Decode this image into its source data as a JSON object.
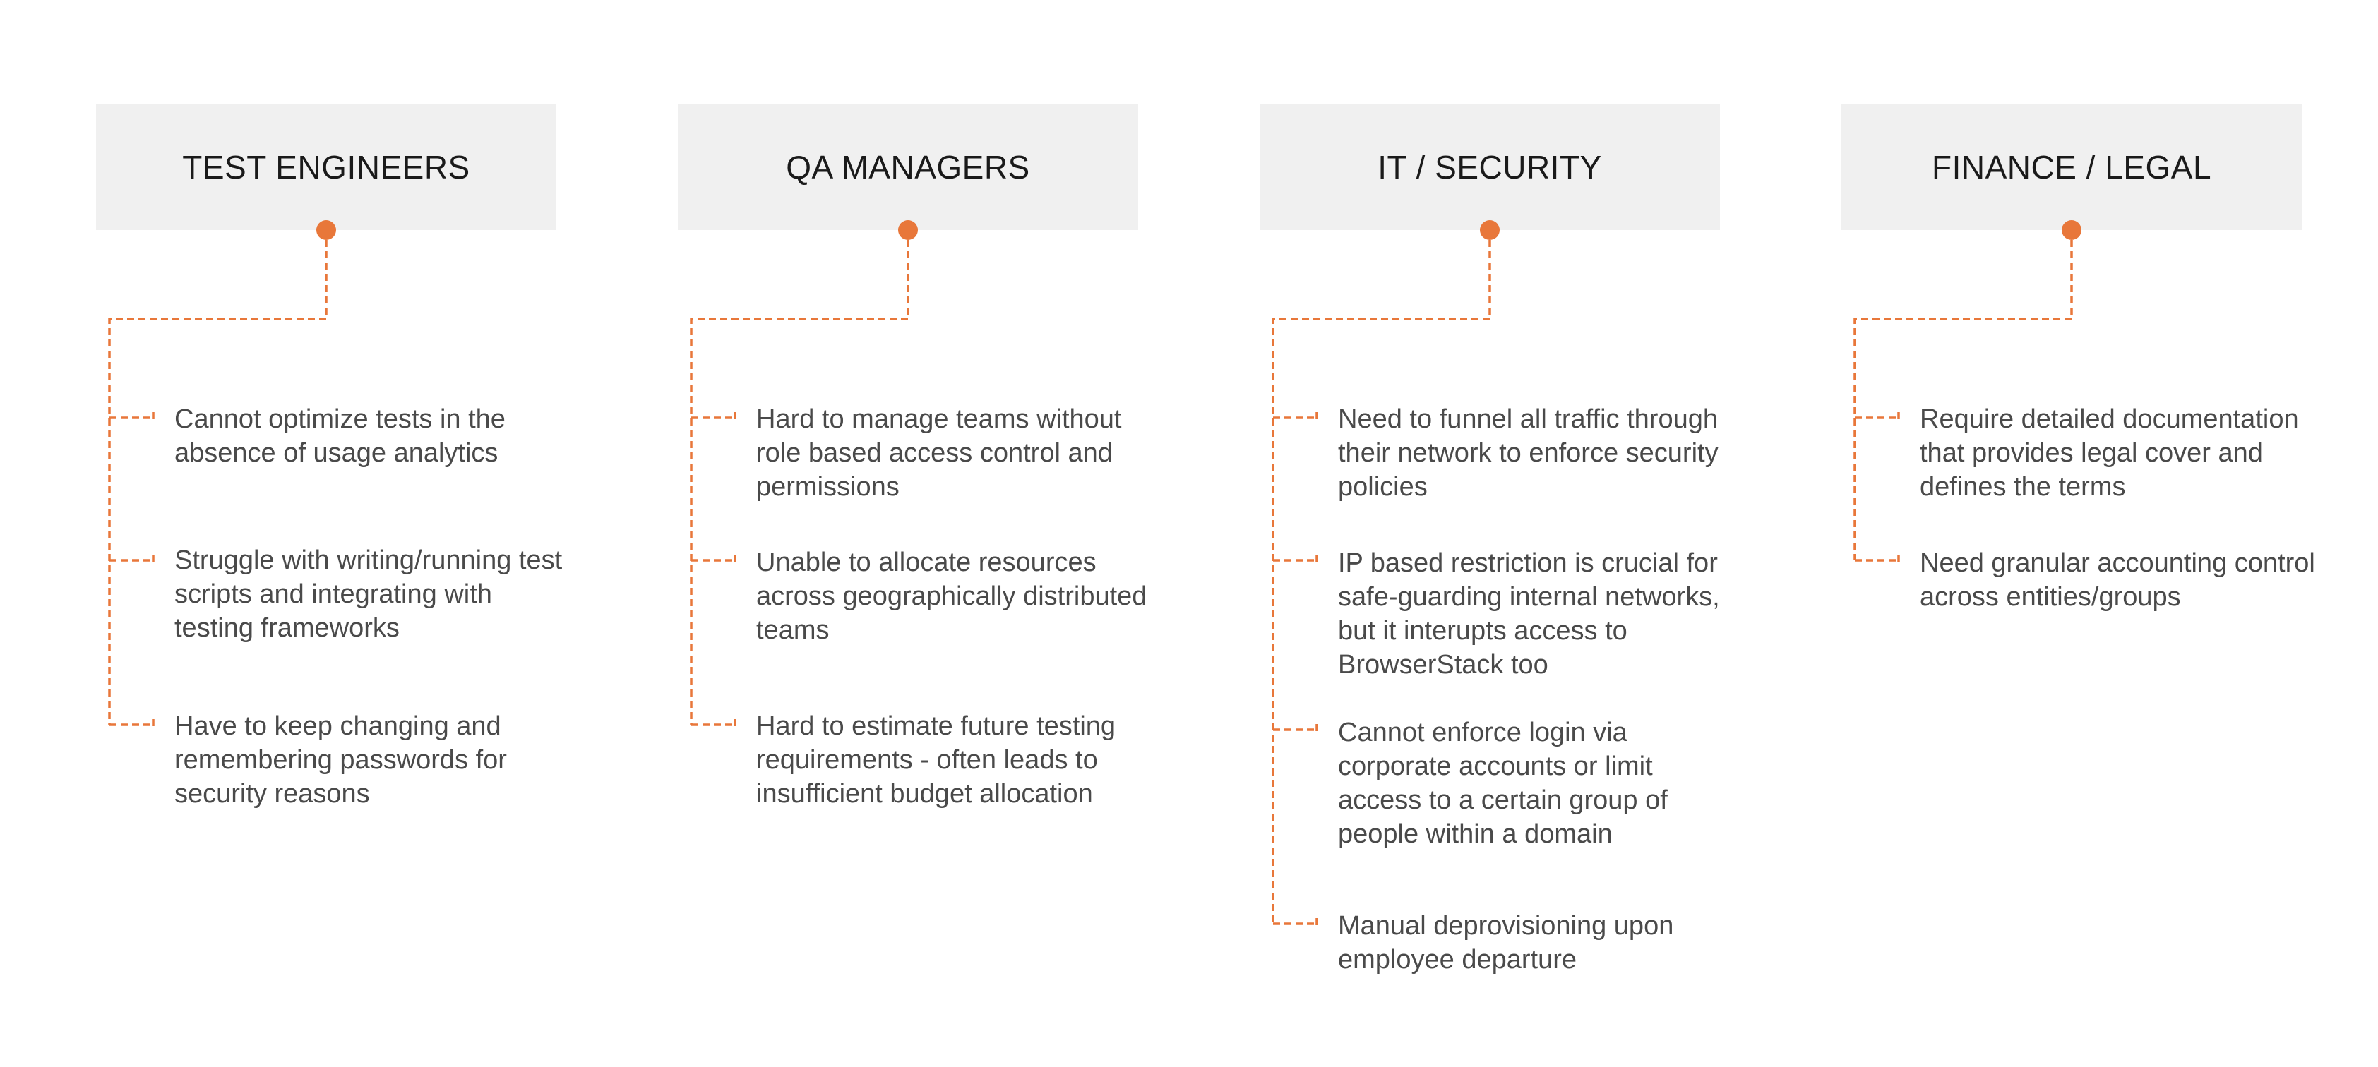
{
  "accent_color": "#e8773a",
  "personas": [
    {
      "title": "TEST ENGINEERS",
      "pain_points": [
        "Cannot optimize tests in the absence of usage analytics",
        "Struggle with writing/running test scripts and integrating with testing frameworks",
        "Have to keep changing and remembering passwords for security reasons"
      ]
    },
    {
      "title": "QA MANAGERS",
      "pain_points": [
        "Hard to manage teams without role based access control and permissions",
        "Unable to allocate resources across geographically distributed teams",
        "Hard to estimate future testing requirements - often leads to insufficient budget allocation"
      ]
    },
    {
      "title": "IT / SECURITY",
      "pain_points": [
        "Need to funnel all traffic through their network to enforce security policies",
        "IP based restriction is crucial for safe-guarding internal networks, but it interupts access to BrowserStack too",
        "Cannot enforce login via corporate accounts or limit access to a certain group of people within a domain",
        "Manual deprovisioning upon employee departure"
      ]
    },
    {
      "title": "FINANCE / LEGAL",
      "pain_points": [
        "Require detailed documentation that provides legal cover and defines the terms",
        "Need granular accounting control across entities/groups"
      ]
    }
  ]
}
